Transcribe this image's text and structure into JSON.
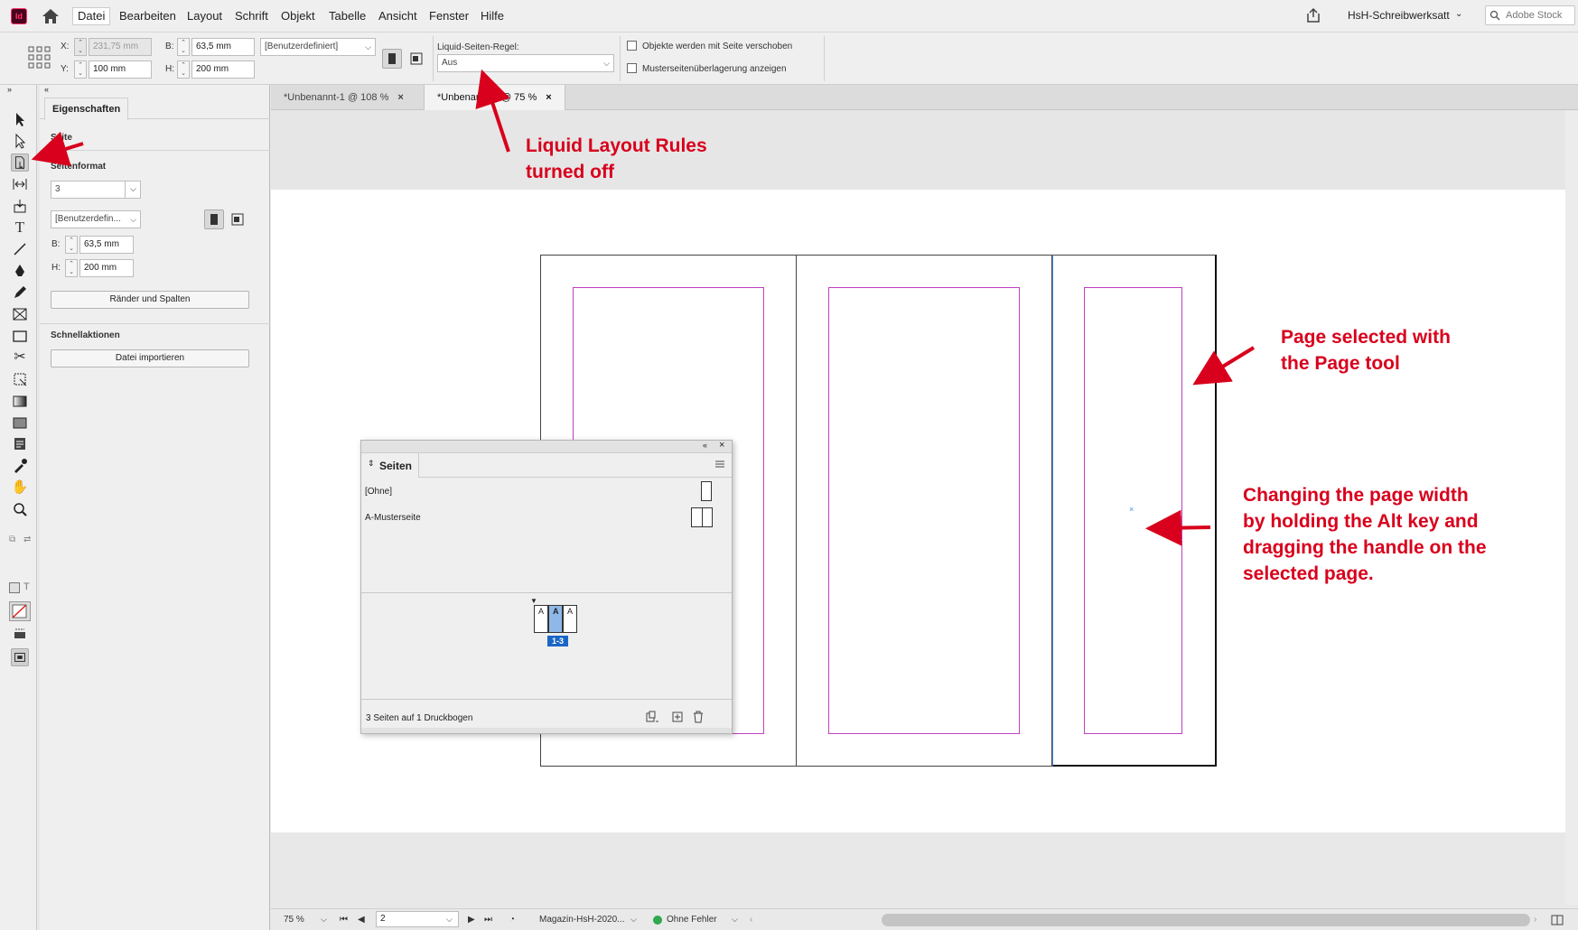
{
  "menu": {
    "app_icon": "Id",
    "items": [
      "Datei",
      "Bearbeiten",
      "Layout",
      "Schrift",
      "Objekt",
      "Tabelle",
      "Ansicht",
      "Fenster",
      "Hilfe"
    ],
    "workspace": "HsH-Schreibwerksatt",
    "stock_placeholder": "Adobe Stock"
  },
  "control": {
    "x_label": "X:",
    "x_value": "231,75 mm",
    "y_label": "Y:",
    "y_value": "100 mm",
    "w_label": "B:",
    "w_value": "63,5 mm",
    "h_label": "H:",
    "h_value": "200 mm",
    "preset": "[Benutzerdefiniert]",
    "liquid_label": "Liquid-Seiten-Regel:",
    "liquid_value": "Aus",
    "check_move": "Objekte werden mit Seite verschoben",
    "check_overlay": "Musterseitenüberlagerung anzeigen"
  },
  "properties": {
    "tab": "Eigenschaften",
    "section_page": "Seite",
    "section_format": "Seitenformat",
    "page_value": "3",
    "preset_value": "[Benutzerdefin...",
    "w_label": "B:",
    "w_value": "63,5 mm",
    "h_label": "H:",
    "h_value": "200 mm",
    "margins_button": "Ränder und Spalten",
    "quick_actions": "Schnellaktionen",
    "import_button": "Datei importieren"
  },
  "doc_tabs": [
    {
      "label": "*Unbenannt-1 @ 108 %",
      "close": "×"
    },
    {
      "label": "*Unbenannt-2 @ 75 %",
      "close": "×"
    }
  ],
  "pages_panel": {
    "title": "Seiten",
    "none_label": "[Ohne]",
    "master_label": "A-Musterseite",
    "spread_letters": [
      "A",
      "A",
      "A"
    ],
    "spread_number": "1-3",
    "footer": "3 Seiten auf 1 Druckbogen"
  },
  "annotations": {
    "liquid": [
      "Liquid Layout Rules",
      "turned off"
    ],
    "page_selected": [
      "Page selected with",
      "the Page tool"
    ],
    "changing": [
      "Changing the page width",
      "by holding the Alt key and",
      "dragging the handle on the",
      "selected page."
    ]
  },
  "status": {
    "zoom": "75 %",
    "page_field": "2",
    "profile": "Magazin-HsH-2020...",
    "preflight": "Ohne Fehler"
  },
  "colors": {
    "annotation": "#d8001c",
    "margin": "#c040c0",
    "selection": "#4a90e2",
    "preflight_ok": "#2fa84f"
  }
}
